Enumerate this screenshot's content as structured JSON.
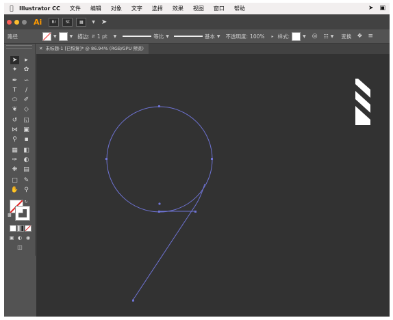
{
  "menubar": {
    "app_name": "Illustrator CC",
    "items": [
      "文件",
      "编辑",
      "对象",
      "文字",
      "选择",
      "效果",
      "视图",
      "窗口",
      "帮助"
    ]
  },
  "appbar": {
    "logo": "Ai",
    "btn1": "Br",
    "btn2": "St"
  },
  "controlbar": {
    "selection_label": "路径",
    "stroke_label": "描边:",
    "stroke_weight": "1 pt",
    "profile_label": "等比",
    "brush_label": "基本",
    "opacity_label": "不透明度:",
    "opacity_value": "100%",
    "style_label": "样式:",
    "transform_label": "变换"
  },
  "document_tab": {
    "title": "未标题-1 [已恢复]* @ 86.94% (RGB/GPU 预览)"
  },
  "colors": {
    "path_color": "#6f74d6",
    "canvas_bg": "#323232",
    "ui_bg": "#535353",
    "accent": "#ff9a00"
  }
}
